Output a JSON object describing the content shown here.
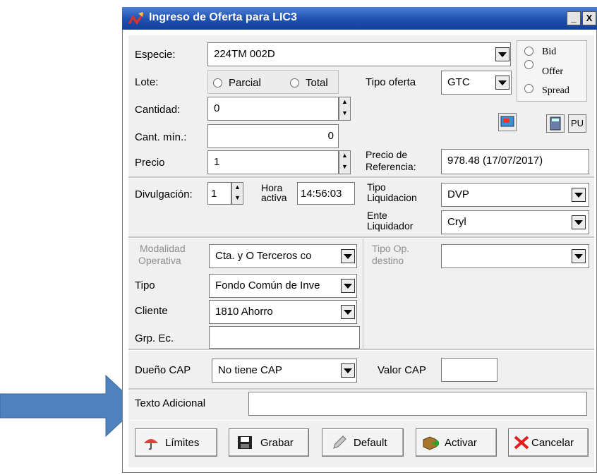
{
  "window": {
    "title": "Ingreso de Oferta para LIC3",
    "minimize": "_",
    "close": "X"
  },
  "especie": {
    "label": "Especie:",
    "value": "224TM    002D"
  },
  "side_ops": {
    "bid": "Bid",
    "offer": "Offer",
    "spread": "Spread"
  },
  "lote": {
    "label": "Lote:",
    "parcial": "Parcial",
    "total": "Total"
  },
  "tipo_oferta": {
    "label": "Tipo oferta",
    "value": "GTC"
  },
  "cantidad": {
    "label": "Cantidad:",
    "value": "0"
  },
  "cant_min": {
    "label": "Cant. mín.:",
    "value": "0"
  },
  "tool_buttons": {
    "pu": "PU"
  },
  "precio": {
    "label": "Precio",
    "value": "1"
  },
  "precio_ref": {
    "label1": "Precio de",
    "label2": "Referencia:",
    "value": "978.48 (17/07/2017)"
  },
  "divulgacion": {
    "label": "Divulgación:",
    "value": "1"
  },
  "hora_activa": {
    "label1": "Hora",
    "label2": "activa",
    "value": "14:56:03"
  },
  "tipo_liquidacion": {
    "label1": "Tipo",
    "label2": "Liquidacion",
    "value": "DVP"
  },
  "ente_liquidador": {
    "label1": "Ente",
    "label2": "Liquidador",
    "value": "Cryl"
  },
  "modalidad": {
    "label1": "Modalidad",
    "label2": "Operativa",
    "value": "Cta. y O Terceros co"
  },
  "tipo_op_destino": {
    "label1": "Tipo Op.",
    "label2": "destino",
    "value": ""
  },
  "tipo": {
    "label": "Tipo",
    "value": "Fondo Común de Inve"
  },
  "cliente": {
    "label": "Cliente",
    "value": "1810 Ahorro"
  },
  "grp_ec": {
    "label": "Grp. Ec.",
    "value": ""
  },
  "dueno_cap": {
    "label": "Dueño CAP",
    "value": "No tiene CAP"
  },
  "valor_cap": {
    "label": "Valor CAP",
    "value": ""
  },
  "texto_adicional": {
    "label": "Texto Adicional",
    "value": ""
  },
  "buttons": {
    "limites": "Límites",
    "grabar": "Grabar",
    "default": "Default",
    "activar": "Activar",
    "cancelar": "Cancelar"
  },
  "colors": {
    "titlebar": "#1f4fb0",
    "arrow": "#4f81bd",
    "panel": "#f0f0f0"
  }
}
